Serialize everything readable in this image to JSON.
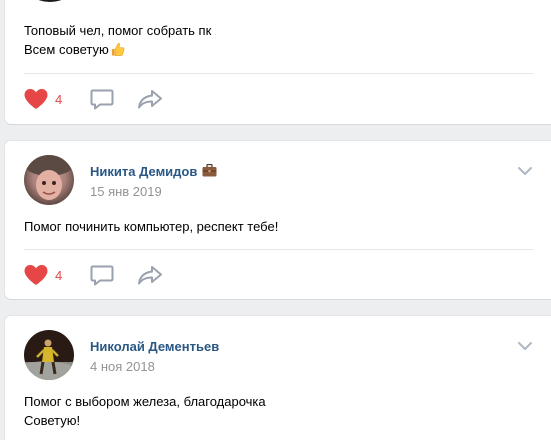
{
  "posts": [
    {
      "text_lines": [
        "Топовый чел, помог собрать пк",
        "Всем советую"
      ],
      "thumbs_emoji": "👍",
      "likes": "4",
      "colors": {
        "like": "#e64646",
        "icons": "#99a2ad"
      }
    },
    {
      "author": "Никита Демидов",
      "author_badge": "briefcase-icon",
      "date": "15 янв 2019",
      "text_lines": [
        "Помог починить компьютер, респект тебе!"
      ],
      "likes": "4"
    },
    {
      "author": "Николай Дементьев",
      "date": "4 ноя 2018",
      "text_lines": [
        "Помог с выбором железа, благодарочка",
        "Советую!"
      ]
    }
  ],
  "theme": {
    "background": "#edeef0",
    "card": "#ffffff",
    "link": "#2a5885",
    "muted": "#939393"
  }
}
